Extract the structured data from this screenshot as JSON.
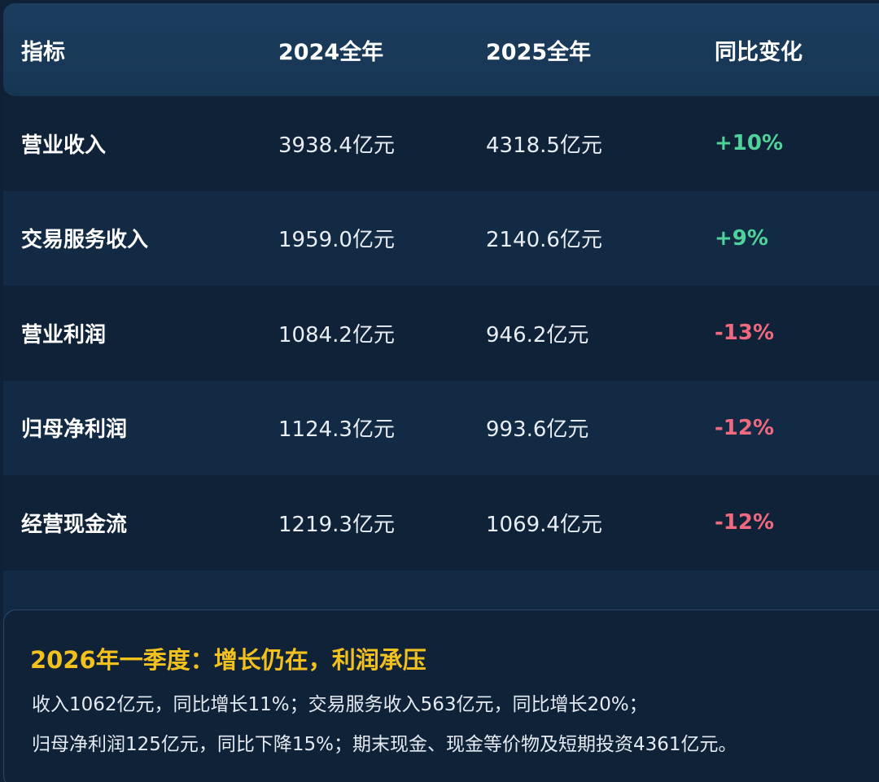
{
  "table": {
    "headers": [
      "指标",
      "2024全年",
      "2025全年",
      "同比变化"
    ],
    "rows": [
      {
        "metric": "营业收入",
        "y2024": "3938.4亿元",
        "y2025": "4318.5亿元",
        "change": "+10%",
        "trend": "up"
      },
      {
        "metric": "交易服务收入",
        "y2024": "1959.0亿元",
        "y2025": "2140.6亿元",
        "change": "+9%",
        "trend": "up"
      },
      {
        "metric": "营业利润",
        "y2024": "1084.2亿元",
        "y2025": "946.2亿元",
        "change": "-13%",
        "trend": "down"
      },
      {
        "metric": "归母净利润",
        "y2024": "1124.3亿元",
        "y2025": "993.6亿元",
        "change": "-12%",
        "trend": "down"
      },
      {
        "metric": "经营现金流",
        "y2024": "1219.3亿元",
        "y2025": "1069.4亿元",
        "change": "-12%",
        "trend": "down"
      }
    ]
  },
  "summary": {
    "title": "2026年一季度：增长仍在，利润承压",
    "line1": "收入1062亿元，同比增长11%；交易服务收入563亿元，同比增长20%；",
    "line2": "归母净利润125亿元，同比下降15%；期末现金、现金等价物及短期投资4361亿元。"
  },
  "colors": {
    "background": "#0f2136",
    "header_bg": "#1c3d5e",
    "positive": "#4fd39a",
    "negative": "#f06a7f",
    "summary_title": "#f3c11d"
  }
}
